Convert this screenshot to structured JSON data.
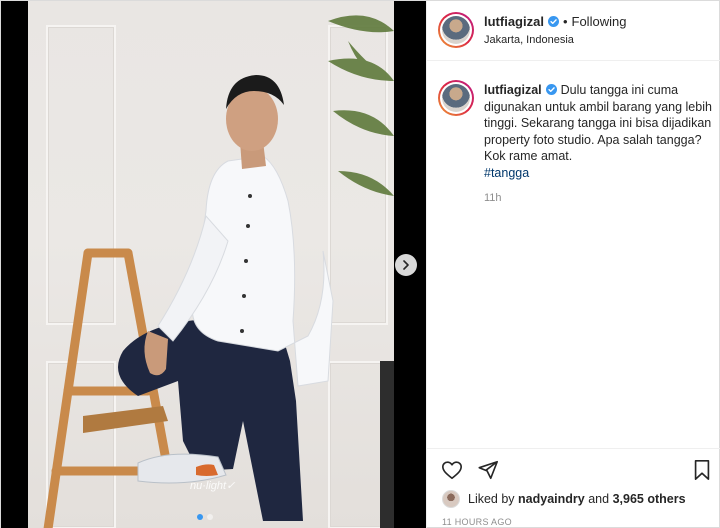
{
  "post": {
    "username": "lutfiagizal",
    "follow_status": "Following",
    "location": "Jakarta, Indonesia",
    "caption_username": "lutfiagizal",
    "caption_text": "Dulu tangga ini cuma digunakan untuk ambil barang yang lebih tinggi. Sekarang tangga ini bisa dijadikan property foto studio. Apa salah tangga? Kok rame amat.",
    "hashtag": "#tangga",
    "caption_time": "11h",
    "liked_by_prefix": "Liked by",
    "liked_by_user": "nadyaindry",
    "liked_by_and": "and",
    "liked_by_others": "3,965 others",
    "posted_ago": "11 HOURS AGO"
  },
  "carousel": {
    "slides": 2,
    "active_slide": 1
  },
  "icons": {
    "verified": "verified-badge-icon",
    "next": "chevron-right-icon",
    "like": "heart-icon",
    "share": "paper-plane-icon",
    "save": "bookmark-icon"
  },
  "colors": {
    "verified": "#3897f0",
    "hashtag": "#00376b",
    "muted": "#8e8e8e",
    "story_ring": "#dc2743"
  }
}
